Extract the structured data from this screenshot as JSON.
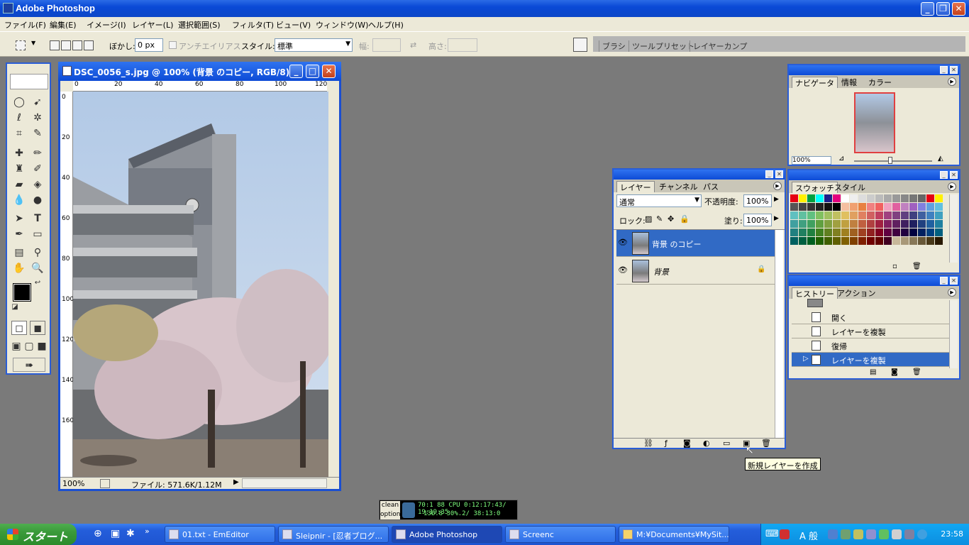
{
  "app": {
    "title": "Adobe Photoshop"
  },
  "menu": [
    "ファイル(F)",
    "編集(E)",
    "イメージ(I)",
    "レイヤー(L)",
    "選択範囲(S)",
    "フィルタ(T)",
    "ビュー(V)",
    "ウィンドウ(W)",
    "ヘルプ(H)"
  ],
  "options": {
    "feather_label": "ぼかし:",
    "feather_value": "0 px",
    "antialias_label": "アンチエイリアス",
    "style_label": "スタイル:",
    "style_value": "標準",
    "width_label": "幅:",
    "height_label": "高さ:",
    "palette_tabs": [
      "ブラシ",
      "ツールプリセット",
      "レイヤーカンプ"
    ]
  },
  "document": {
    "title": "DSC_0056_s.jpg @ 100% (背景 のコピー, RGB/8)",
    "ruler_h": [
      "0",
      "20",
      "40",
      "60",
      "80",
      "100",
      "120"
    ],
    "ruler_v": [
      "0",
      "20",
      "40",
      "60",
      "80",
      "100",
      "120",
      "140",
      "160"
    ],
    "zoom": "100%",
    "file_info": "ファイル: 571.6K/1.12M"
  },
  "navigator": {
    "tabs": [
      "ナビゲータ",
      "情報",
      "カラー"
    ],
    "zoom": "100%"
  },
  "swatches": {
    "tabs": [
      "スウォッチ",
      "スタイル"
    ],
    "colors": [
      [
        "#e60012",
        "#fff100",
        "#00a040",
        "#00ffff",
        "#1d2088",
        "#e4007f",
        "#ffffff",
        "#eeeeee",
        "#dddddd",
        "#cccccc",
        "#bbbbbb",
        "#aaaaaa",
        "#999999",
        "#888888",
        "#777777",
        "#666666",
        "#e60012",
        "#fff100"
      ],
      [
        "#555555",
        "#444444",
        "#333333",
        "#222222",
        "#111111",
        "#000000",
        "#f5c0a0",
        "#f0a070",
        "#e88040",
        "#f08080",
        "#f06060",
        "#f0a0c0",
        "#e060a0",
        "#c080c0",
        "#a060c0",
        "#8080e0",
        "#60a0e0",
        "#60c0e0"
      ],
      [
        "#60c0c0",
        "#60c0a0",
        "#60c080",
        "#80c060",
        "#a0c060",
        "#c0c060",
        "#e0c060",
        "#e0a060",
        "#e08060",
        "#d06060",
        "#c04060",
        "#a04080",
        "#804080",
        "#604080",
        "#404080",
        "#4060a0",
        "#4080c0",
        "#40a0c0"
      ],
      [
        "#40a0a0",
        "#40a080",
        "#40a060",
        "#60a040",
        "#80a040",
        "#a0a040",
        "#c0a040",
        "#c08040",
        "#c06040",
        "#b04040",
        "#a02040",
        "#802060",
        "#602060",
        "#402060",
        "#202060",
        "#204080",
        "#2060a0",
        "#2080a0"
      ],
      [
        "#208080",
        "#208060",
        "#208040",
        "#408020",
        "#608020",
        "#808020",
        "#a08020",
        "#a06020",
        "#a04020",
        "#902020",
        "#800020",
        "#600040",
        "#400040",
        "#200040",
        "#000040",
        "#002060",
        "#004080",
        "#006080"
      ],
      [
        "#006060",
        "#006040",
        "#006020",
        "#206000",
        "#406000",
        "#606000",
        "#806000",
        "#804000",
        "#802000",
        "#700000",
        "#600000",
        "#400020",
        "#c8b89a",
        "#a89878",
        "#887858",
        "#685838",
        "#483818",
        "#281800"
      ]
    ]
  },
  "layers": {
    "tabs": [
      "レイヤー",
      "チャンネル",
      "パス"
    ],
    "blend_mode": "通常",
    "opacity_label": "不透明度:",
    "opacity": "100%",
    "lock_label": "ロック:",
    "fill_label": "塗り:",
    "fill": "100%",
    "items": [
      {
        "name": "背景 のコピー",
        "selected": true
      },
      {
        "name": "背景",
        "selected": false,
        "locked": true
      }
    ]
  },
  "history": {
    "tabs": [
      "ヒストリー",
      "アクション"
    ],
    "items": [
      {
        "label": "開く",
        "selected": false
      },
      {
        "label": "レイヤーを複製",
        "selected": false
      },
      {
        "label": "復帰",
        "selected": false
      },
      {
        "label": "レイヤーを複製",
        "selected": true
      }
    ]
  },
  "tooltip": "新規レイヤーを作成",
  "meter": {
    "labels": [
      "clean",
      "option"
    ],
    "line1": "70:1 88 CPU  0:12:17:43/ 19:19:35",
    "line2": "13b.8  30%.2/ 38:13:0"
  },
  "taskbar": {
    "start": "スタート",
    "tasks": [
      {
        "label": "01.txt - EmEditor",
        "active": false
      },
      {
        "label": "Sleipnir - [忍者ブログ...",
        "active": false
      },
      {
        "label": "Adobe Photoshop",
        "active": true
      },
      {
        "label": "Screenc",
        "active": false
      },
      {
        "label": "M:¥Documents¥MySit...",
        "active": false
      }
    ],
    "ime": "A 般",
    "clock": "23:58"
  }
}
